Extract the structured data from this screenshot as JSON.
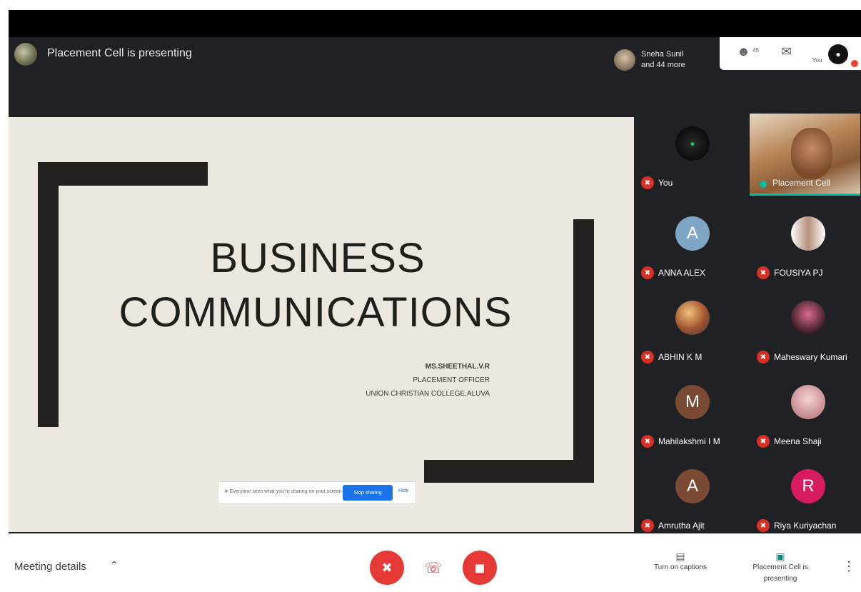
{
  "header": {
    "presenting_text": "Placement Cell is presenting",
    "people_name": "Sneha Sunil",
    "people_more": "and 44 more",
    "you_label": "You",
    "participants_count": "45",
    "chat_count": ""
  },
  "slide": {
    "title_line1": "BUSINESS",
    "title_line2": "COMMUNICATIONS",
    "presenter_name": "MS.SHEETHAL.V.R",
    "presenter_role": "PLACEMENT OFFICER",
    "presenter_org": "UNION CHRISTIAN COLLEGE,ALUVA"
  },
  "share_bar": {
    "notice": "⊗ Everyone sees what you're sharing on your screen",
    "stop_label": "Stop sharing",
    "hide_label": "Hide"
  },
  "tiles": [
    {
      "name": "You",
      "initial": "",
      "color": "#111111"
    },
    {
      "name": "Placement Cell",
      "initial": "",
      "color": ""
    },
    {
      "name": "ANNA ALEX",
      "initial": "A",
      "color": "#7da7c4"
    },
    {
      "name": "FOUSIYA PJ",
      "initial": "",
      "color": "#c9b3a6"
    },
    {
      "name": "ABHIN K M",
      "initial": "",
      "color": "#6a7b8c"
    },
    {
      "name": "Maheswary Kumari",
      "initial": "",
      "color": "#4a2a2a"
    },
    {
      "name": "Mahilakshmi I M",
      "initial": "M",
      "color": "#7a4a35"
    },
    {
      "name": "Meena Shaji",
      "initial": "",
      "color": "#e0b6b9"
    },
    {
      "name": "Amrutha Ajit",
      "initial": "A",
      "color": "#7a4a35"
    },
    {
      "name": "Riya Kuriyachan",
      "initial": "R",
      "color": "#d81b60"
    }
  ],
  "bottom": {
    "meeting_details": "Meeting details",
    "captions_label": "Turn on captions",
    "presenting_label": "Placement Cell is presenting"
  },
  "colors": {
    "accent_red": "#e53935",
    "teal": "#00bfa5",
    "dark_bg": "#202124"
  }
}
